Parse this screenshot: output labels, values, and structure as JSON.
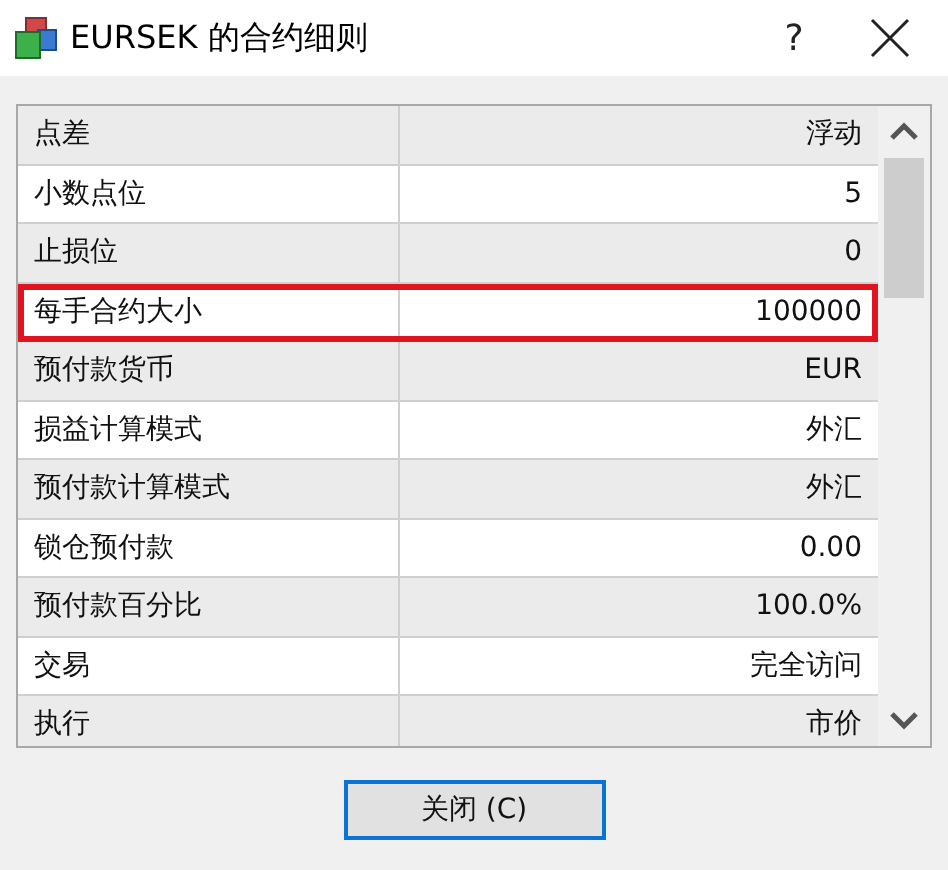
{
  "window": {
    "title": "EURSEK 的合约细则",
    "help": "?"
  },
  "table": {
    "rows": [
      {
        "name": "点差",
        "value": "浮动",
        "highlighted": false
      },
      {
        "name": "小数点位",
        "value": "5",
        "highlighted": false
      },
      {
        "name": "止损位",
        "value": "0",
        "highlighted": false
      },
      {
        "name": "每手合约大小",
        "value": "100000",
        "highlighted": true
      },
      {
        "name": "预付款货币",
        "value": "EUR",
        "highlighted": false
      },
      {
        "name": "损益计算模式",
        "value": "外汇",
        "highlighted": false
      },
      {
        "name": "预付款计算模式",
        "value": "外汇",
        "highlighted": false
      },
      {
        "name": "锁仓预付款",
        "value": "0.00",
        "highlighted": false
      },
      {
        "name": "预付款百分比",
        "value": "100.0%",
        "highlighted": false
      },
      {
        "name": "交易",
        "value": "完全访问",
        "highlighted": false
      },
      {
        "name": "执行",
        "value": "市价",
        "highlighted": false
      }
    ]
  },
  "buttons": [
    {
      "label": "关闭 (C)",
      "focused": true
    }
  ]
}
